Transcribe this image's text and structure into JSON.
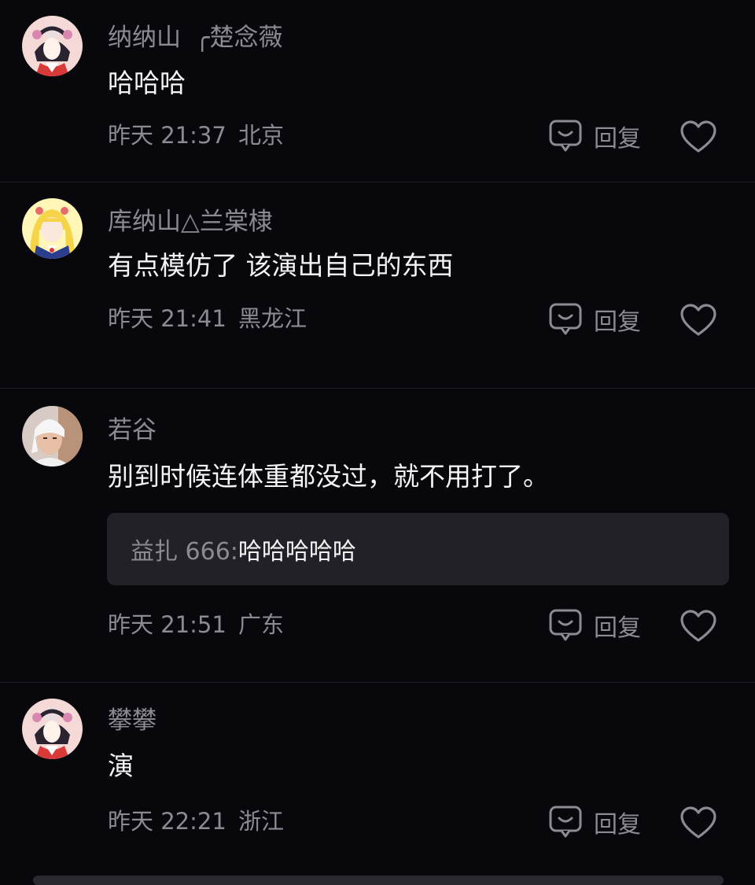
{
  "comments": [
    {
      "username": "纳纳山",
      "username_extra": "╭楚念薇",
      "text": "哈哈哈",
      "time": "昨天 21:37",
      "location": "北京",
      "reply_label": "回复",
      "avatar_icon": "opera-girl-avatar"
    },
    {
      "username": "库纳山△兰棠棣",
      "text": "有点模仿了 该演出自己的东西",
      "time": "昨天 21:41",
      "location": "黑龙江",
      "reply_label": "回复",
      "avatar_icon": "blonde-anime-girl-avatar"
    },
    {
      "username": "若谷",
      "text": "别到时候连体重都没过，就不用打了。",
      "sub_reply": {
        "author": "益扎 666:",
        "text": "哈哈哈哈哈"
      },
      "time": "昨天 21:51",
      "location": "广东",
      "reply_label": "回复",
      "avatar_icon": "bandaged-man-avatar"
    },
    {
      "username": "攀攀",
      "text": "演",
      "time": "昨天 22:21",
      "location": "浙江",
      "reply_label": "回复",
      "avatar_icon": "opera-girl-avatar"
    }
  ],
  "colors": {
    "background": "#08070c",
    "muted_text": "#8c8b92",
    "primary_text": "#f4f4f6",
    "sub_reply_bg": "#222127"
  }
}
